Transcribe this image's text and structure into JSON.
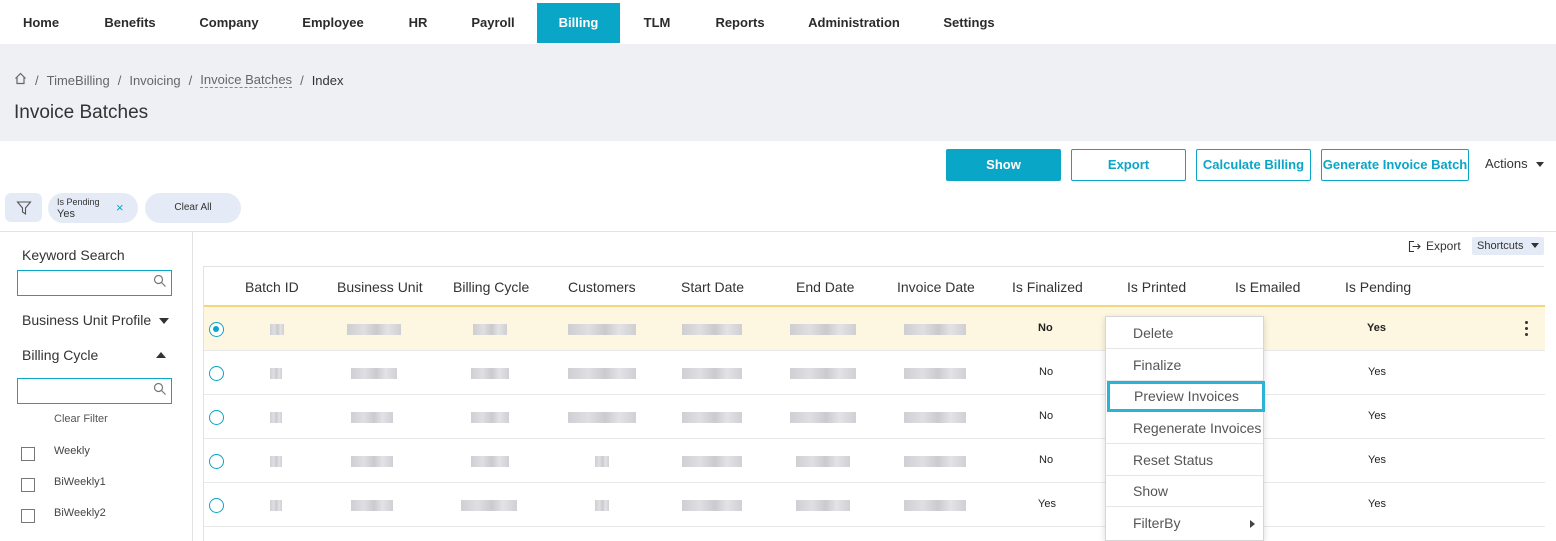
{
  "nav": {
    "items": [
      "Home",
      "Benefits",
      "Company",
      "Employee",
      "HR",
      "Payroll",
      "Billing",
      "TLM",
      "Reports",
      "Administration",
      "Settings"
    ],
    "active": "Billing"
  },
  "breadcrumb": {
    "items": [
      "TimeBilling",
      "Invoicing",
      "Invoice Batches",
      "Index"
    ]
  },
  "page": {
    "title": "Invoice Batches"
  },
  "toolbar": {
    "show": "Show",
    "export": "Export",
    "calculate_billing": "Calculate Billing",
    "generate_invoice_batch": "Generate Invoice Batch",
    "actions": "Actions"
  },
  "filters": {
    "chip": {
      "label": "Is Pending",
      "value": "Yes",
      "remove": "×"
    },
    "clear_all": "Clear All"
  },
  "sidebar": {
    "keyword_search": "Keyword Search",
    "business_unit_profile": "Business Unit Profile",
    "billing_cycle": "Billing Cycle",
    "clear_filter": "Clear Filter",
    "options": [
      "Weekly",
      "BiWeekly1",
      "BiWeekly2"
    ]
  },
  "grid": {
    "export": "Export",
    "shortcuts": "Shortcuts",
    "columns": [
      "Batch ID",
      "Business Unit",
      "Billing Cycle",
      "Customers",
      "Start Date",
      "End Date",
      "Invoice Date",
      "Is Finalized",
      "Is Printed",
      "Is Emailed",
      "Is Pending"
    ],
    "rows": [
      {
        "is_finalized": "No",
        "is_pending": "Yes",
        "selected": true
      },
      {
        "is_finalized": "No",
        "is_pending": "Yes",
        "selected": false
      },
      {
        "is_finalized": "No",
        "is_pending": "Yes",
        "selected": false
      },
      {
        "is_finalized": "No",
        "is_pending": "Yes",
        "selected": false
      },
      {
        "is_finalized": "Yes",
        "is_pending": "Yes",
        "selected": false
      }
    ]
  },
  "context_menu": {
    "items": [
      "Delete",
      "Finalize",
      "Preview Invoices",
      "Regenerate Invoices",
      "Reset Status",
      "Show",
      "FilterBy"
    ],
    "highlighted": "Preview Invoices"
  },
  "colors": {
    "accent": "#0aa6c7",
    "header_band": "#eef0f4",
    "selected_row": "#fdf6e0"
  },
  "icons": {
    "filter": "funnel-icon",
    "home": "home-icon",
    "search": "search-icon",
    "export": "export-icon",
    "more": "kebab-icon"
  }
}
